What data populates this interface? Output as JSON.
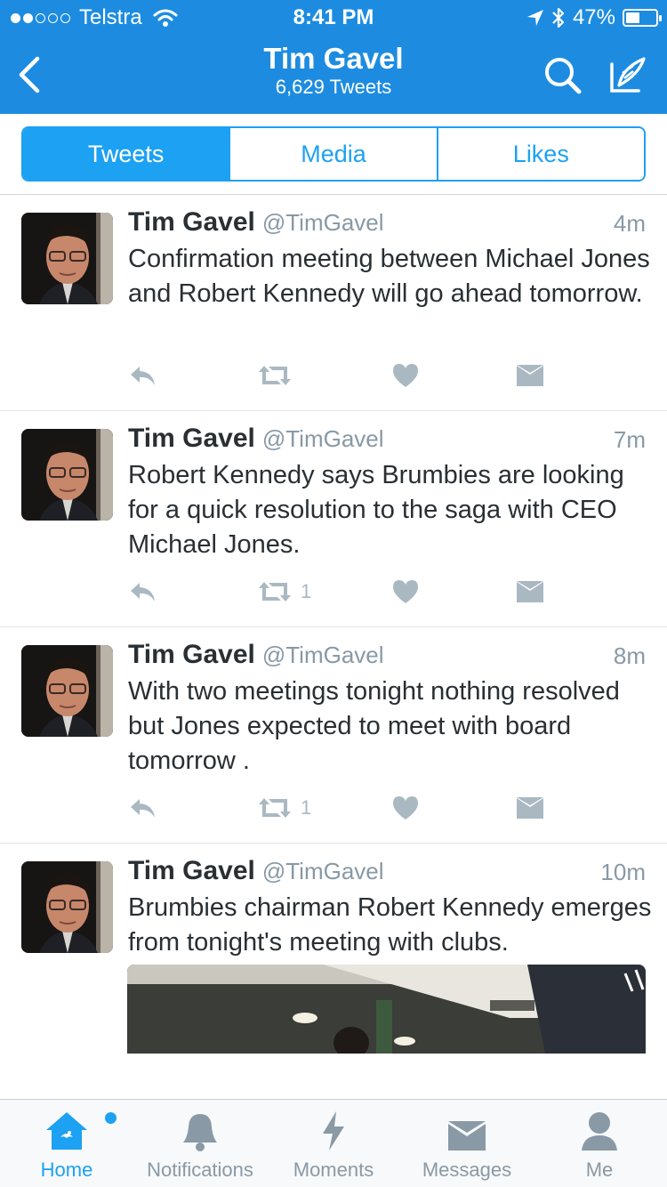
{
  "status_bar": {
    "carrier": "Telstra",
    "time": "8:41 PM",
    "battery": "47%",
    "battery_level": 0.47
  },
  "nav": {
    "title": "Tim Gavel",
    "subtitle": "6,629 Tweets",
    "icons": [
      "back-chevron-icon",
      "search-icon",
      "compose-icon"
    ]
  },
  "segments": {
    "items": [
      "Tweets",
      "Media",
      "Likes"
    ],
    "active": "Tweets"
  },
  "tweets": [
    {
      "name": "Tim Gavel",
      "handle": "@TimGavel",
      "time": "4m",
      "text": "Confirmation meeting between Michael Jones and Robert Kennedy will go ahead tomorrow.",
      "retweets": ""
    },
    {
      "name": "Tim Gavel",
      "handle": "@TimGavel",
      "time": "7m",
      "text": "Robert Kennedy says Brumbies are looking for a quick resolution to the saga with CEO Michael Jones.",
      "retweets": "1"
    },
    {
      "name": "Tim Gavel",
      "handle": "@TimGavel",
      "time": "8m",
      "text": "With two meetings tonight nothing resolved but Jones expected to meet with board tomorrow .",
      "retweets": "1"
    },
    {
      "name": "Tim Gavel",
      "handle": "@TimGavel",
      "time": "10m",
      "text": "Brumbies chairman Robert Kennedy emerges from tonight's meeting with clubs.",
      "retweets": ""
    }
  ],
  "tab_bar": {
    "items": [
      "Home",
      "Notifications",
      "Moments",
      "Messages",
      "Me"
    ],
    "active": "Home"
  },
  "colors": {
    "brand": "#1d8ce0",
    "accent": "#1da1f2",
    "icon_gray": "#aab8c2",
    "meta_gray": "#8899a6"
  }
}
